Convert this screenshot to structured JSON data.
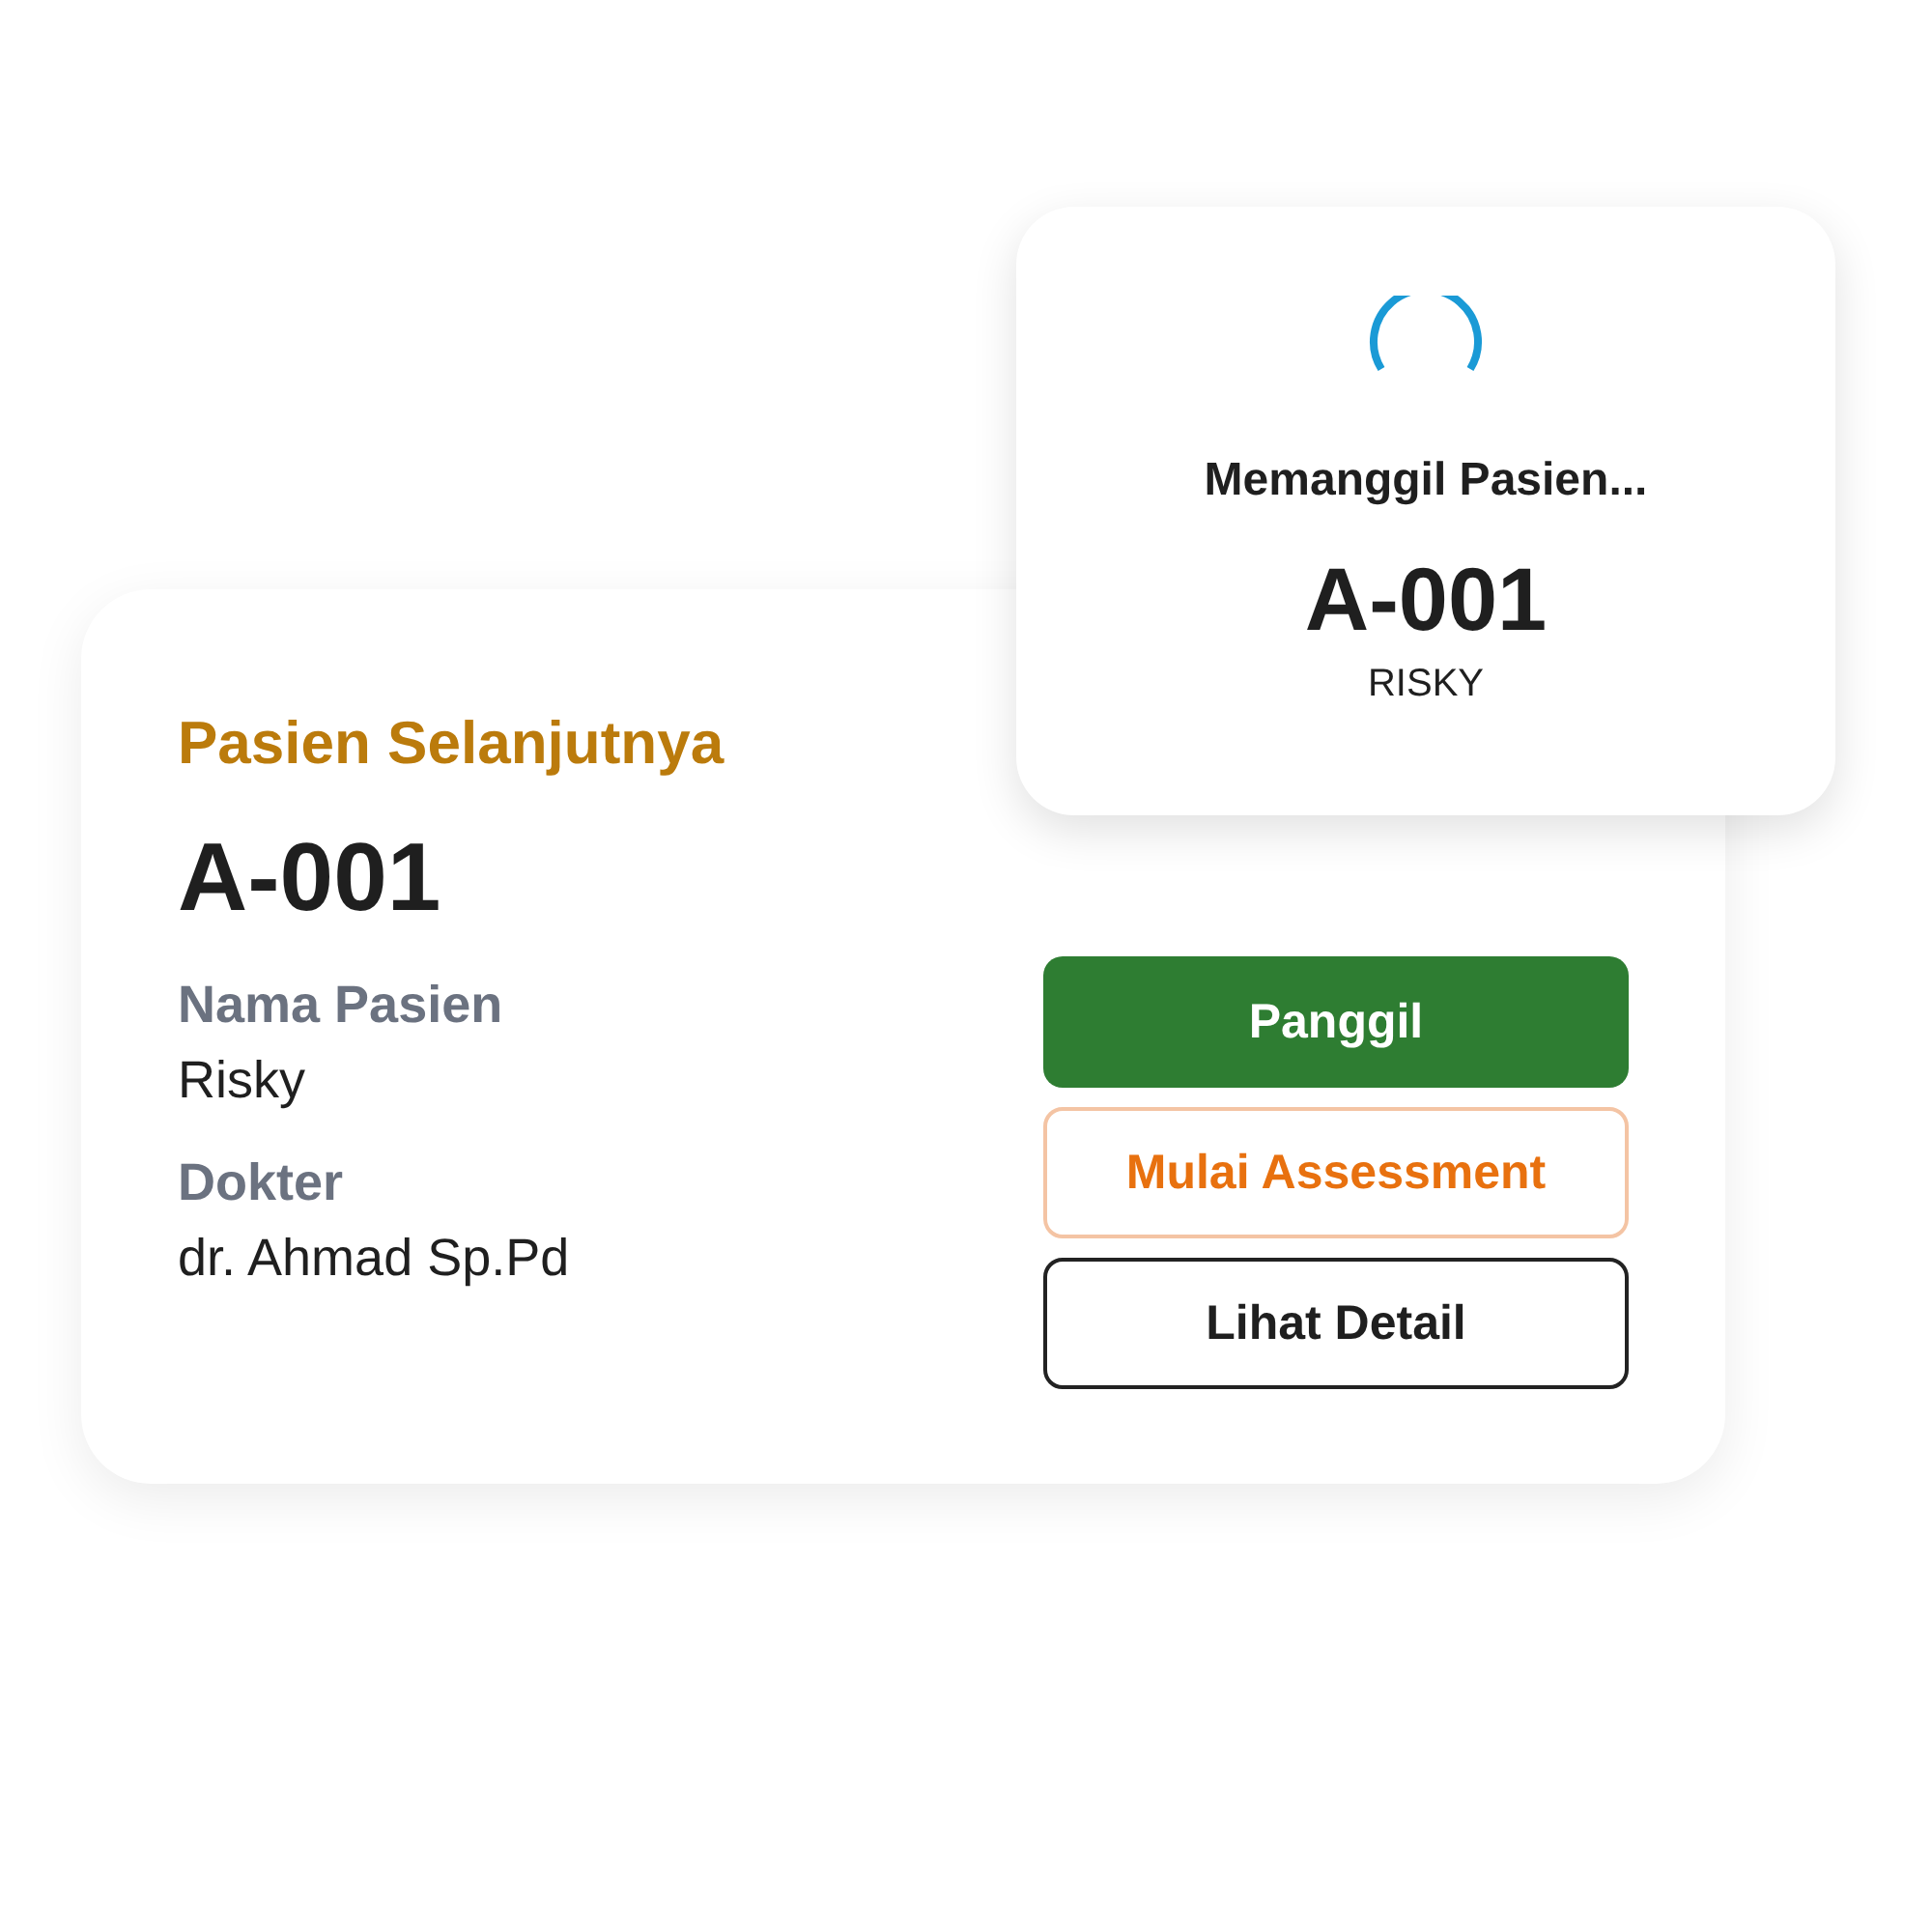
{
  "patient_card": {
    "title": "Pasien Selanjutnya",
    "queue_number": "A-001",
    "fields": [
      {
        "label": "Nama Pasien",
        "value": "Risky"
      },
      {
        "label": "Dokter",
        "value": "dr. Ahmad Sp.Pd"
      }
    ],
    "buttons": [
      {
        "label": "Panggil",
        "kind": "primary"
      },
      {
        "label": "Mulai Assessment",
        "kind": "warning"
      },
      {
        "label": "Lihat Detail",
        "kind": "outline"
      }
    ]
  },
  "calling_dialog": {
    "title": "Memanggil Pasien...",
    "queue_number": "A-001",
    "patient_name": "RISKY"
  }
}
